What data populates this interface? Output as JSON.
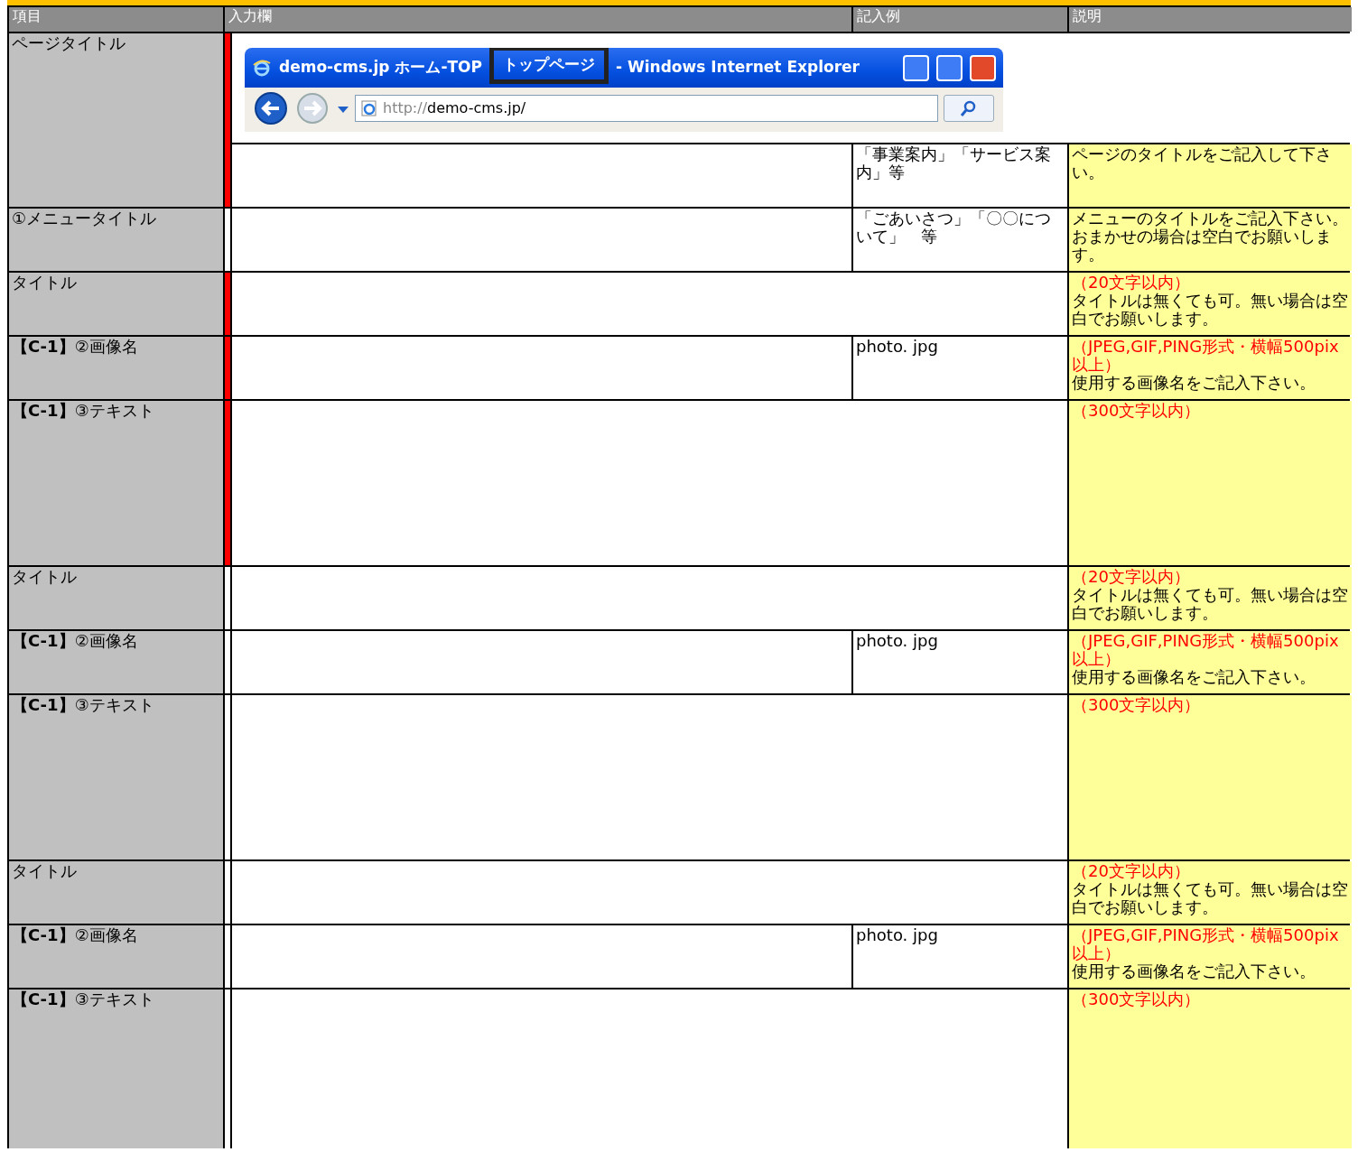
{
  "header": [
    "項目",
    "入力欄",
    "記入例",
    "説明"
  ],
  "browser": {
    "title_site": "demo-cms.jp ホーム-TOP",
    "title_page": "トップページ",
    "title_app": "- Windows Internet Explorer",
    "address_scheme": "http://",
    "address_rest": "demo-cms.jp/"
  },
  "rows": [
    {
      "kind": "page",
      "label": "ページタイトル",
      "required": true,
      "example": "「事業案内」「サービス案内」等",
      "note": "ページのタイトルをご記入して下さい。"
    },
    {
      "kind": "short",
      "label": "①メニュータイトル",
      "required": false,
      "example": "「ごあいさつ」「〇〇について」　等",
      "note": "メニューのタイトルをご記入下さい。おまかせの場合は空白でお願いします。"
    },
    {
      "kind": "short",
      "label": "タイトル",
      "required": true,
      "limit": "（20文字以内）",
      "note": "タイトルは無くても可。無い場合は空白でお願いします。"
    },
    {
      "kind": "short",
      "label": "**【C-1】**②画像名",
      "required": true,
      "example": "photo. jpg",
      "limit": "（JPEG,GIF,PING形式・横幅500pix以上）",
      "note": "使用する画像名をご記入下さい。"
    },
    {
      "kind": "long",
      "label": "**【C-1】**③テキスト",
      "required": true,
      "limit": "（300文字以内）"
    },
    {
      "kind": "short",
      "label": "タイトル",
      "required": false,
      "limit": "（20文字以内）",
      "note": "タイトルは無くても可。無い場合は空白でお願いします。"
    },
    {
      "kind": "short",
      "label": "**【C-1】**②画像名",
      "required": false,
      "example": "photo. jpg",
      "limit": "（JPEG,GIF,PING形式・横幅500pix以上）",
      "note": "使用する画像名をご記入下さい。"
    },
    {
      "kind": "long",
      "label": "**【C-1】**③テキスト",
      "required": false,
      "limit": "（300文字以内）"
    },
    {
      "kind": "short",
      "label": "タイトル",
      "required": false,
      "limit": "（20文字以内）",
      "note": "タイトルは無くても可。無い場合は空白でお願いします。"
    },
    {
      "kind": "short",
      "label": "**【C-1】**②画像名",
      "required": false,
      "example": "photo. jpg",
      "limit": "（JPEG,GIF,PING形式・横幅500pix以上）",
      "note": "使用する画像名をご記入下さい。"
    },
    {
      "kind": "last",
      "label": "**【C-1】**③テキスト",
      "required": false,
      "limit": "（300文字以内）"
    }
  ]
}
